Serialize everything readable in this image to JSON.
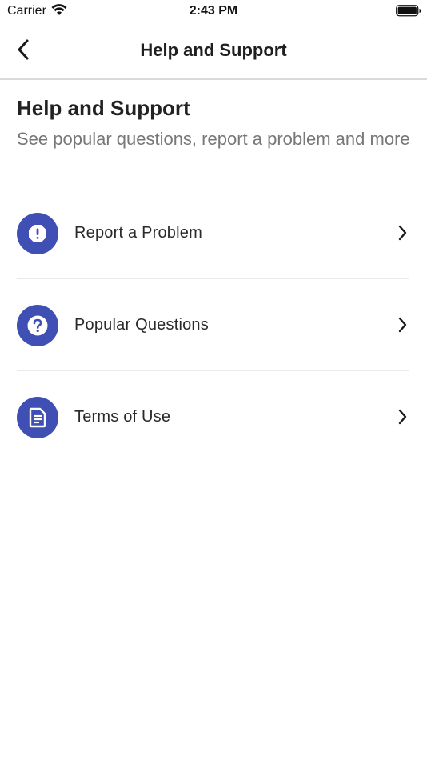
{
  "status_bar": {
    "carrier": "Carrier",
    "time": "2:43 PM"
  },
  "nav": {
    "title": "Help and Support",
    "back_icon": "chevron-left-icon"
  },
  "header": {
    "title": "Help and Support",
    "subtitle": "See popular questions, report a problem and more"
  },
  "menu": {
    "items": [
      {
        "label": "Report a Problem",
        "icon": "alert-octagon-icon"
      },
      {
        "label": "Popular Questions",
        "icon": "help-circle-icon"
      },
      {
        "label": "Terms of Use",
        "icon": "document-icon"
      }
    ]
  },
  "colors": {
    "accent": "#3f4fb3",
    "title_text": "#222222",
    "subtitle_text": "#777777",
    "divider": "#e9e9e9"
  }
}
